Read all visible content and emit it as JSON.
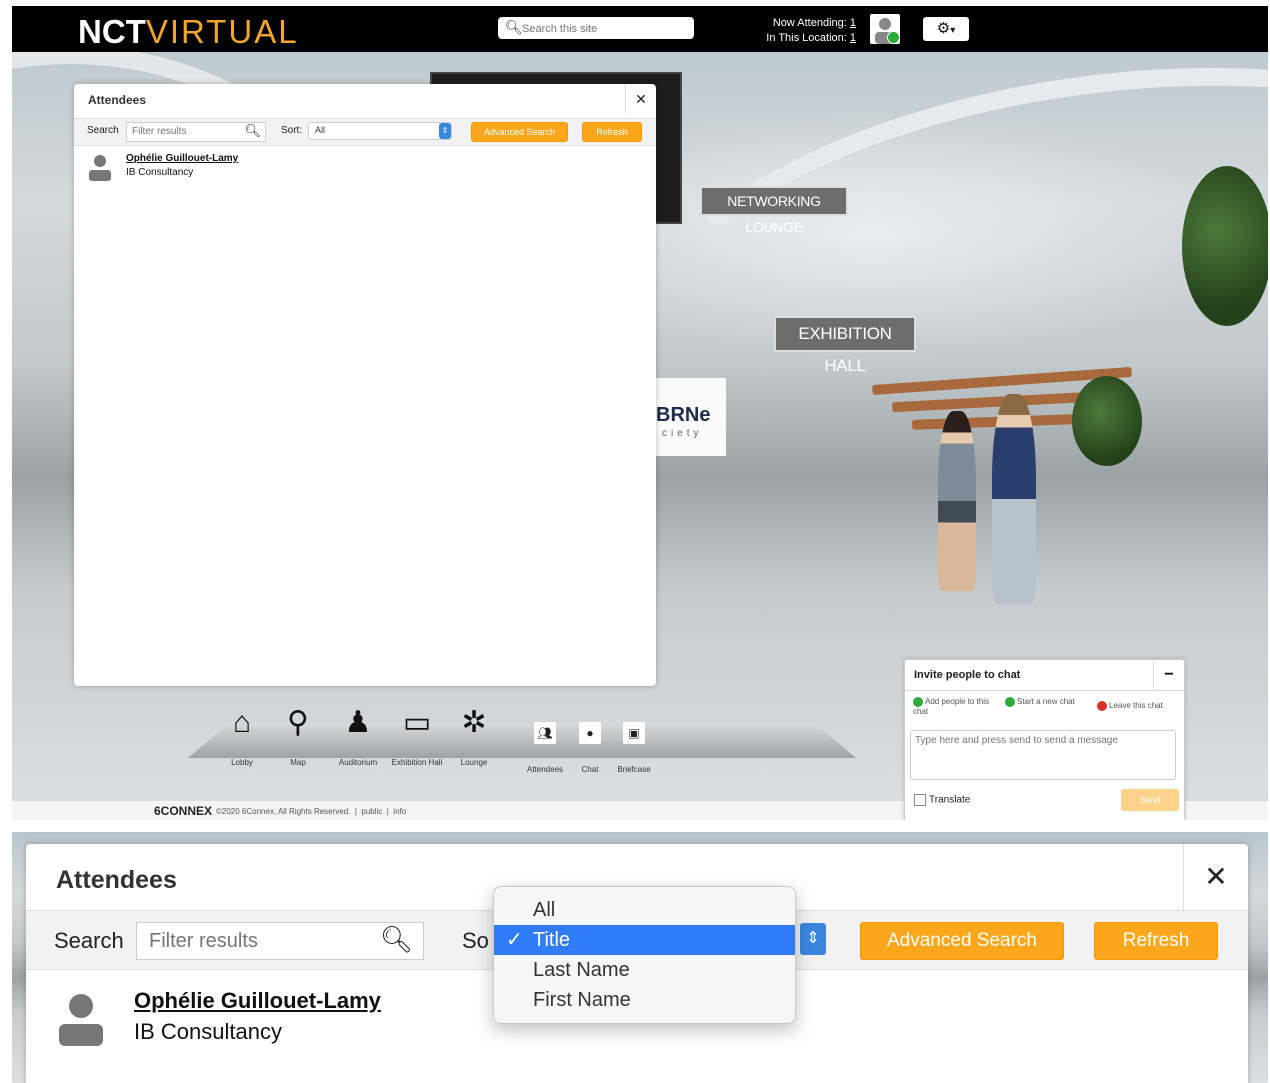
{
  "header": {
    "logo_nct": "NCT",
    "logo_virtual": "VIRTUAL",
    "search_placeholder": "Search this site",
    "now_attending_label": "Now Attending:",
    "now_attending_count": "1",
    "in_location_label": "In This Location:",
    "in_location_count": "1"
  },
  "scene": {
    "networking_sign": "NETWORKING LOUNGE",
    "exhibition_sign": "EXHIBITION HALL",
    "booth_text_1": "BRNe",
    "booth_text_2": "ciety"
  },
  "attendees_panel": {
    "title": "Attendees",
    "search_label": "Search",
    "filter_placeholder": "Filter results",
    "sort_label": "Sort:",
    "sort_value": "All",
    "advanced_search": "Advanced Search",
    "refresh": "Refresh",
    "attendees": [
      {
        "name": "Ophélie Guillouet-Lamy",
        "company": "IB Consultancy"
      }
    ]
  },
  "dock": {
    "items": [
      "Lobby",
      "Map",
      "Auditorium",
      "Exhibition Hall",
      "Lounge",
      "Attendees",
      "Chat",
      "Briefcase"
    ]
  },
  "footer": {
    "brand": "6CONNEX",
    "copyright": "©2020 6Connex, All Rights Reserved.",
    "sep": "|",
    "public_link": "public",
    "info_link": "info"
  },
  "chat": {
    "title": "Invite people to chat",
    "minimize": "−",
    "add_people": "Add people to this chat",
    "start_new": "Start a new chat",
    "leave": "Leave this chat",
    "message_placeholder": "Type here and press send to send a message",
    "translate": "Translate",
    "send": "Send"
  },
  "zoom": {
    "title": "Attendees",
    "search_label": "Search",
    "filter_placeholder": "Filter results",
    "sort_label_partial": "So",
    "advanced_search": "Advanced Search",
    "refresh": "Refresh",
    "sort_options": [
      "All",
      "Title",
      "Last Name",
      "First Name"
    ],
    "selected_option": "Title",
    "attendee_name": "Ophélie Guillouet-Lamy",
    "attendee_company": "IB Consultancy"
  },
  "colors": {
    "accent_orange": "#fca61b",
    "header_black": "#000000",
    "select_blue": "#2f7cf6",
    "online_green": "#2daa3a"
  }
}
